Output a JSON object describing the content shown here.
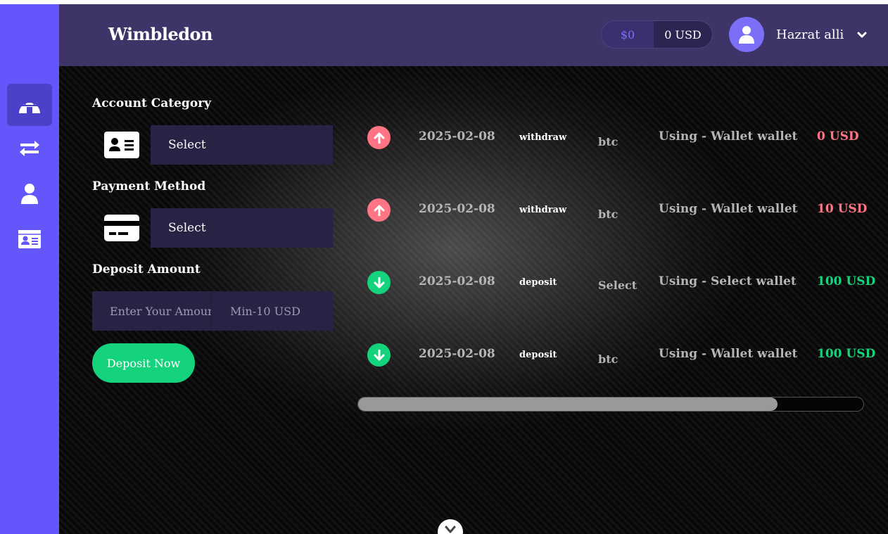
{
  "app": {
    "brand": "Wimbledon"
  },
  "sidebar": {
    "items": [
      {
        "icon": "dashboard-igloo-icon",
        "active": true
      },
      {
        "icon": "exchange-arrows-icon",
        "active": false
      },
      {
        "icon": "user-icon",
        "active": false
      },
      {
        "icon": "id-card-icon",
        "active": false
      }
    ]
  },
  "header": {
    "balance_dollar": "$0",
    "balance_usd": "0 USD",
    "user_name": "Hazrat alli",
    "avatar_icon": "user-icon",
    "menu_icon": "chevron-down-icon"
  },
  "form": {
    "account_category_label": "Account Category",
    "account_category_value": "Select",
    "account_category_icon": "id-card-icon",
    "payment_method_label": "Payment Method",
    "payment_method_value": "Select",
    "payment_method_icon": "credit-card-icon",
    "deposit_amount_label": "Deposit Amount",
    "amount_placeholder": "Enter Your Amount",
    "amount_min": "Min-10 USD",
    "submit_label": "Deposit Now"
  },
  "transactions": [
    {
      "direction": "up",
      "date": "2025-02-08",
      "type": "withdraw",
      "coin": "btc",
      "note": "Using - Wallet wallet",
      "amount": "0 USD"
    },
    {
      "direction": "up",
      "date": "2025-02-08",
      "type": "withdraw",
      "coin": "btc",
      "note": "Using - Wallet wallet",
      "amount": "10 USD"
    },
    {
      "direction": "down",
      "date": "2025-02-08",
      "type": "deposit",
      "coin": "Select",
      "note": "Using - Select wallet",
      "amount": "100 USD"
    },
    {
      "direction": "down",
      "date": "2025-02-08",
      "type": "deposit",
      "coin": "btc",
      "note": "Using - Wallet wallet",
      "amount": "100 USD"
    }
  ],
  "scroll": {
    "visible_fraction": 0.83
  },
  "colors": {
    "sidebar": "#6356fb",
    "header": "#3e3468",
    "accent": "#7b6ff7",
    "withdraw": "#ff7585",
    "deposit": "#15d37c"
  }
}
